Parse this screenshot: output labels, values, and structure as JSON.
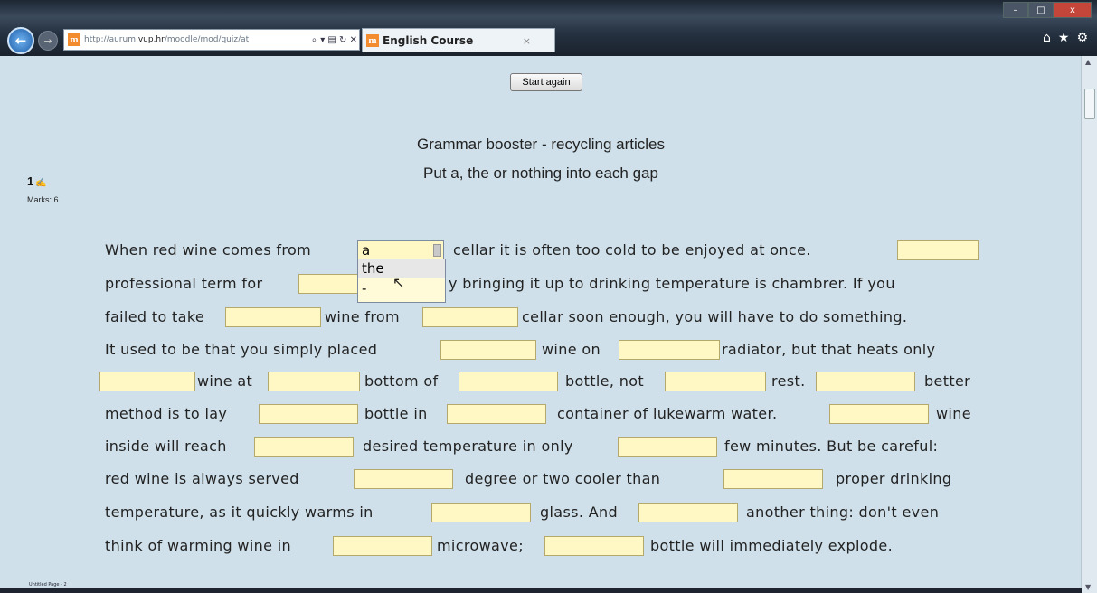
{
  "browser": {
    "url_prefix": "http://aurum.",
    "url_domain": "vup.hr",
    "url_suffix": "/moodle/mod/quiz/at",
    "tab_title": "English Course",
    "tab_close": "×",
    "win_minimize": "–",
    "win_maximize": "□",
    "win_close": "x",
    "back_glyph": "←",
    "fwd_glyph": "→",
    "search_glyph": "⌕",
    "addr_icons": "▾ ▤ ↻ ✕",
    "home_glyph": "⌂",
    "star_glyph": "★",
    "gear_glyph": "⚙"
  },
  "quiz": {
    "start_again": "Start again",
    "title": "Grammar booster - recycling articles",
    "instructions": "Put a, the or nothing into each gap",
    "question_number": "1",
    "marks": "Marks: 6"
  },
  "dropdown": {
    "selected": "a",
    "options": [
      "the",
      "-"
    ]
  },
  "text": {
    "l1a": "When red wine comes from",
    "l1b": "cellar it is often too cold to be enjoyed at once.",
    "l2a": "professional term for",
    "l2b": "y bringing it up to drinking temperature is chambrer. If you",
    "l3a": "failed to take",
    "l3b": "wine from",
    "l3c": "cellar soon enough, you will have to do something.",
    "l4a": "It used to be that you simply placed",
    "l4b": "wine on",
    "l4c": "radiator, but that heats only",
    "l5a": "wine at",
    "l5b": "bottom of",
    "l5c": "bottle, not",
    "l5d": "rest.",
    "l5e": "better",
    "l6a": "method is to lay",
    "l6b": "bottle in",
    "l6c": "container of lukewarm water.",
    "l6d": "wine",
    "l7a": "inside will reach",
    "l7b": "desired temperature in only",
    "l7c": "few minutes. But be careful:",
    "l8a": "red wine is always served",
    "l8b": "degree or two cooler than",
    "l8c": "proper drinking",
    "l9a": "temperature, as it quickly warms in",
    "l9b": "glass. And",
    "l9c": "another thing: don't even",
    "l10a": "think of warming wine in",
    "l10b": "microwave;",
    "l10c": "bottle will immediately explode."
  },
  "taskbar": {
    "label": "Untitled Page - 2"
  },
  "icons": {
    "question_flag": "✍",
    "cursor": "↖"
  }
}
